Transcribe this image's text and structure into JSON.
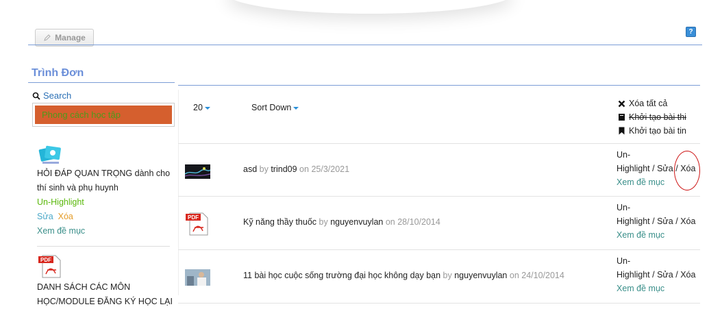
{
  "toolbar": {
    "manage_label": "Manage",
    "help_icon": "help-icon"
  },
  "sidebar": {
    "title": "Trình Đơn",
    "search_label": "Search",
    "category": "Phong cách học tập",
    "items": [
      {
        "icon": "photo-cards-icon",
        "title_line1": "HỎI ĐÁP QUAN TRỌNG dành cho",
        "title_line2": "thí sinh và phụ huynh",
        "highlight": "Un-Highlight",
        "edit": "Sửa",
        "delete": "Xóa",
        "view": "Xem đề mục"
      },
      {
        "icon": "pdf-icon",
        "title_line1": "DANH SÁCH CÁC MÔN",
        "title_line2": "HỌC/MODULE ĐĂNG KÝ HỌC LẠI"
      }
    ]
  },
  "list": {
    "page_size": "20",
    "sort": "Sort Down",
    "actions": {
      "delete_all": "Xóa tất cả",
      "create_exam": "Khởi tạo bài thi",
      "create_post": "Khởi tạo bài tin"
    },
    "rows": [
      {
        "thumb": "image-thumb-icon",
        "title": "asd",
        "by": "by",
        "author": "trind09",
        "on": "on",
        "date": "25/3/2021",
        "unhl": "Un-",
        "hl": "Highlight",
        "slash1": "/",
        "edit": "Sửa",
        "slash2": "/",
        "delete": "Xóa",
        "view": "Xem đề mục"
      },
      {
        "thumb": "pdf-icon",
        "title": "Kỹ năng thầy thuốc",
        "by": "by",
        "author": "nguyenvuylan",
        "on": "on",
        "date": "28/10/2014",
        "unhl": "Un-",
        "hl": "Highlight",
        "slash1": "/",
        "edit": "Sửa",
        "slash2": "/",
        "delete": "Xóa",
        "view": "Xem đề mục"
      },
      {
        "thumb": "photo-thumb-icon",
        "title": "11 bài học cuộc sống trường đại học không dạy bạn",
        "by": "by",
        "author": "nguyenvuylan",
        "on": "on",
        "date": "24/10/2014",
        "unhl": "Un-",
        "hl": "Highlight",
        "slash1": "/",
        "edit": "Sửa",
        "slash2": "/",
        "delete": "Xóa",
        "view": "Xem đề mục"
      }
    ]
  },
  "colors": {
    "accent": "#6b8fd9",
    "category_bg": "#d55f2e",
    "link": "#3a8f8a",
    "annotation": "#cc1111"
  }
}
